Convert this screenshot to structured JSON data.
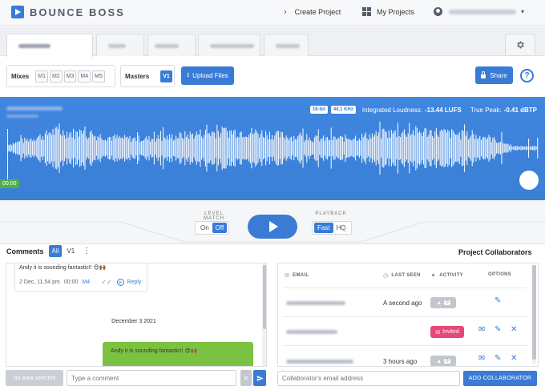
{
  "app": {
    "name": "BOUNCE BOSS"
  },
  "nav": {
    "create_project": "Create Project",
    "my_projects": "My Projects"
  },
  "toolbar": {
    "mixes_label": "Mixes",
    "mixes": [
      "M1",
      "M2",
      "M3",
      "M4",
      "M5"
    ],
    "masters_label": "Masters",
    "masters": [
      "V1"
    ],
    "upload_label": "Upload Files",
    "share_label": "Share",
    "help_glyph": "?"
  },
  "waveform": {
    "bit_depth": "16-bit",
    "sample_rate": "44.1 KHz",
    "integrated_loudness_label": "Integrated Loudness:",
    "integrated_loudness_value": "-13.44 LUFS",
    "true_peak_label": "True Peak:",
    "true_peak_value": "-0.41 dBTP",
    "timecode": "00:00",
    "colors": {
      "background": "#3b7fd6",
      "wave": "#ffffff",
      "timecode": "#4fb04a"
    }
  },
  "transport": {
    "level_match_label": "LEVEL MATCH",
    "level_match_on": "On",
    "level_match_off": "Off",
    "level_match_selected": "Off",
    "playback_label": "PLAYBACK",
    "playback_fast": "Fast",
    "playback_hq": "HQ",
    "playback_selected": "Fast"
  },
  "comments": {
    "title": "Comments",
    "filter_all": "All",
    "filter_v1": "V1",
    "more_glyph": "⋮",
    "items": [
      {
        "text": "Andy it is sounding fantastic!! 😍🙌🏾",
        "date": "2 Dec, 11.54 pm",
        "time": "00:00",
        "mix": "M4",
        "reply_label": "Reply"
      }
    ],
    "date_separator": "December 3 2021",
    "bubble_text": "Andy it is sounding fantastic!! 😍🙌🏾",
    "no_area_label": "No area selected",
    "input_placeholder": "Type a comment",
    "clear_glyph": "✕"
  },
  "collaborators": {
    "title": "Project Collaborators",
    "headers": {
      "email": "EMAIL",
      "last_seen": "LAST SEEN",
      "activity": "ACTIVITY",
      "options": "OPTIONS"
    },
    "rows": [
      {
        "last_seen": "A second ago",
        "activity_count": "0",
        "status": ""
      },
      {
        "last_seen": "",
        "activity_count": "",
        "status": "Invited"
      },
      {
        "last_seen": "3 hours ago",
        "activity_count": "0",
        "status": ""
      }
    ],
    "input_placeholder": "Collaborator's email address",
    "add_label": "ADD COLLABORATOR",
    "colors": {
      "accent": "#3a7bd5",
      "invited": "#e9467a"
    }
  }
}
